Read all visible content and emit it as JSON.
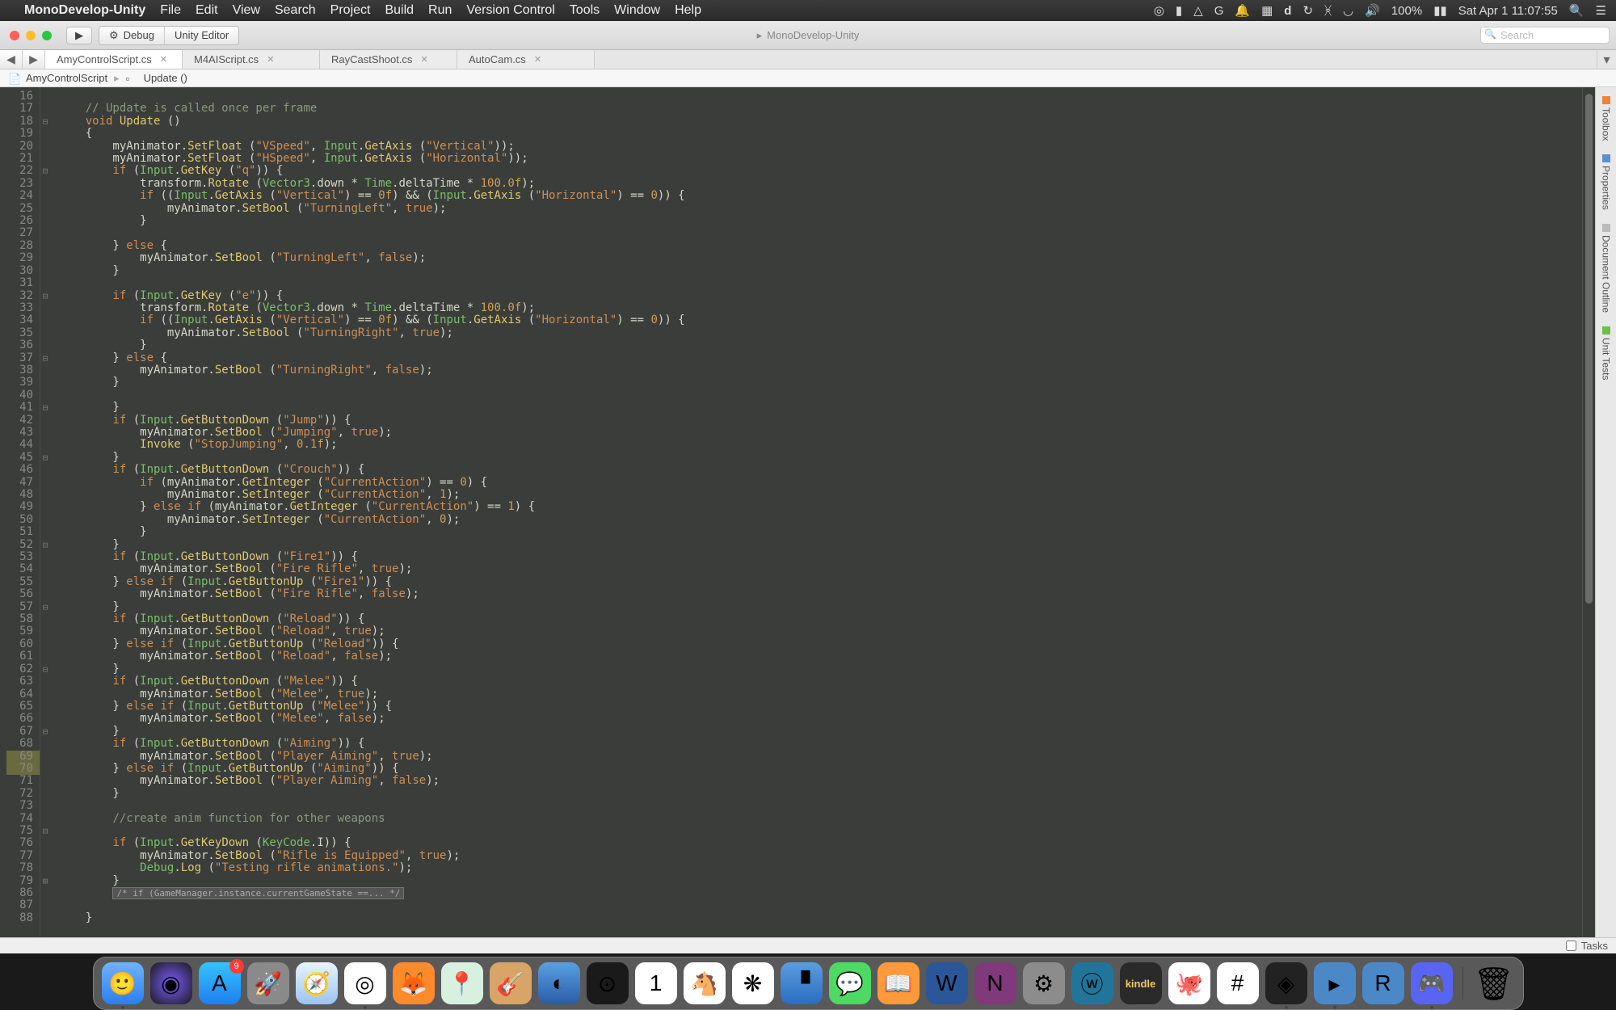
{
  "menubar": {
    "app_name": "MonoDevelop-Unity",
    "items": [
      "File",
      "Edit",
      "View",
      "Search",
      "Project",
      "Build",
      "Run",
      "Version Control",
      "Tools",
      "Window",
      "Help"
    ],
    "status": {
      "battery": "100%",
      "clock": "Sat Apr 1  11:07:55"
    }
  },
  "toolbar": {
    "run_config": "Debug",
    "target": "Unity Editor",
    "app_title": "MonoDevelop-Unity",
    "search_placeholder": "Search"
  },
  "tabs": [
    {
      "label": "AmyControlScript.cs",
      "active": true
    },
    {
      "label": "M4AIScript.cs",
      "active": false
    },
    {
      "label": "RayCastShoot.cs",
      "active": false
    },
    {
      "label": "AutoCam.cs",
      "active": false
    }
  ],
  "breadcrumb": {
    "file": "AmyControlScript",
    "member": "Update ()"
  },
  "side_panels": [
    "Toolbox",
    "Properties",
    "Document Outline",
    "Unit Tests"
  ],
  "tasks_label": "Tasks",
  "editor": {
    "first_line_no": 16,
    "marked_lines": [
      69,
      70
    ],
    "fold_markers": {
      "18": "⊟",
      "22": "⊟",
      "32": "⊟",
      "37": "⊟",
      "41": "⊟",
      "45": "⊟",
      "52": "⊟",
      "57": "⊟",
      "62": "⊟",
      "67": "⊟",
      "75": "⊟",
      "79": "⊞"
    },
    "lines_html": [
      "",
      "    <span class='c-cmt'>// Update is called once per frame</span>",
      "    <span class='c-kw'>void</span> <span class='c-call'>Update</span> ()",
      "    {",
      "        myAnimator.<span class='c-call'>SetFloat</span> (<span class='c-str'>\"VSpeed\"</span>, <span class='c-call2'>Input</span>.<span class='c-call'>GetAxis</span> (<span class='c-str'>\"Vertical\"</span>));",
      "        myAnimator.<span class='c-call'>SetFloat</span> (<span class='c-str'>\"HSpeed\"</span>, <span class='c-call2'>Input</span>.<span class='c-call'>GetAxis</span> (<span class='c-str'>\"Horizontal\"</span>));",
      "        <span class='c-kw'>if</span> (<span class='c-call2'>Input</span>.<span class='c-call'>GetKey</span> (<span class='c-str'>\"q\"</span>)) {",
      "            transform.<span class='c-call'>Rotate</span> (<span class='c-call2'>Vector3</span>.down * <span class='c-call2'>Time</span>.deltaTime * <span class='c-num'>100.0f</span>);",
      "            <span class='c-kw'>if</span> ((<span class='c-call2'>Input</span>.<span class='c-call'>GetAxis</span> (<span class='c-str'>\"Vertical\"</span>) == <span class='c-num'>0f</span>) &amp;&amp; (<span class='c-call2'>Input</span>.<span class='c-call'>GetAxis</span> (<span class='c-str'>\"Horizontal\"</span>) == <span class='c-num'>0</span>)) {",
      "                myAnimator.<span class='c-call'>SetBool</span> (<span class='c-str'>\"TurningLeft\"</span>, <span class='c-kw'>true</span>);",
      "            }",
      "",
      "        } <span class='c-kw'>else</span> {",
      "            myAnimator.<span class='c-call'>SetBool</span> (<span class='c-str'>\"TurningLeft\"</span>, <span class='c-kw'>false</span>);",
      "        }",
      "",
      "        <span class='c-kw'>if</span> (<span class='c-call2'>Input</span>.<span class='c-call'>GetKey</span> (<span class='c-str'>\"e\"</span>)) {",
      "            transform.<span class='c-call'>Rotate</span> (<span class='c-call2'>Vector3</span>.down * <span class='c-call2'>Time</span>.deltaTime * <span class='c-num'>100.0f</span>);",
      "            <span class='c-kw'>if</span> ((<span class='c-call2'>Input</span>.<span class='c-call'>GetAxis</span> (<span class='c-str'>\"Vertical\"</span>) == <span class='c-num'>0f</span>) &amp;&amp; (<span class='c-call2'>Input</span>.<span class='c-call'>GetAxis</span> (<span class='c-str'>\"Horizontal\"</span>) == <span class='c-num'>0</span>)) {",
      "                myAnimator.<span class='c-call'>SetBool</span> (<span class='c-str'>\"TurningRight\"</span>, <span class='c-kw'>true</span>);",
      "            }",
      "        } <span class='c-kw'>else</span> {",
      "            myAnimator.<span class='c-call'>SetBool</span> (<span class='c-str'>\"TurningRight\"</span>, <span class='c-kw'>false</span>);",
      "        }",
      "",
      "        }",
      "        <span class='c-kw'>if</span> (<span class='c-call2'>Input</span>.<span class='c-call'>GetButtonDown</span> (<span class='c-str'>\"Jump\"</span>)) {",
      "            myAnimator.<span class='c-call'>SetBool</span> (<span class='c-str'>\"Jumping\"</span>, <span class='c-kw'>true</span>);",
      "            <span class='c-call'>Invoke</span> (<span class='c-str'>\"StopJumping\"</span>, <span class='c-num'>0.1f</span>);",
      "        }",
      "        <span class='c-kw'>if</span> (<span class='c-call2'>Input</span>.<span class='c-call'>GetButtonDown</span> (<span class='c-str'>\"Crouch\"</span>)) {",
      "            <span class='c-kw'>if</span> (myAnimator.<span class='c-call'>GetInteger</span> (<span class='c-str'>\"CurrentAction\"</span>) == <span class='c-num'>0</span>) {",
      "                myAnimator.<span class='c-call'>SetInteger</span> (<span class='c-str'>\"CurrentAction\"</span>, <span class='c-num'>1</span>);",
      "            } <span class='c-kw'>else if</span> (myAnimator.<span class='c-call'>GetInteger</span> (<span class='c-str'>\"CurrentAction\"</span>) == <span class='c-num'>1</span>) {",
      "                myAnimator.<span class='c-call'>SetInteger</span> (<span class='c-str'>\"CurrentAction\"</span>, <span class='c-num'>0</span>);",
      "            }",
      "        }",
      "        <span class='c-kw'>if</span> (<span class='c-call2'>Input</span>.<span class='c-call'>GetButtonDown</span> (<span class='c-str'>\"Fire1\"</span>)) {",
      "            myAnimator.<span class='c-call'>SetBool</span> (<span class='c-str'>\"Fire Rifle\"</span>, <span class='c-kw'>true</span>);",
      "        } <span class='c-kw'>else if</span> (<span class='c-call2'>Input</span>.<span class='c-call'>GetButtonUp</span> (<span class='c-str'>\"Fire1\"</span>)) {",
      "            myAnimator.<span class='c-call'>SetBool</span> (<span class='c-str'>\"Fire Rifle\"</span>, <span class='c-kw'>false</span>);",
      "        }",
      "        <span class='c-kw'>if</span> (<span class='c-call2'>Input</span>.<span class='c-call'>GetButtonDown</span> (<span class='c-str'>\"Reload\"</span>)) {",
      "            myAnimator.<span class='c-call'>SetBool</span> (<span class='c-str'>\"Reload\"</span>, <span class='c-kw'>true</span>);",
      "        } <span class='c-kw'>else if</span> (<span class='c-call2'>Input</span>.<span class='c-call'>GetButtonUp</span> (<span class='c-str'>\"Reload\"</span>)) {",
      "            myAnimator.<span class='c-call'>SetBool</span> (<span class='c-str'>\"Reload\"</span>, <span class='c-kw'>false</span>);",
      "        }",
      "        <span class='c-kw'>if</span> (<span class='c-call2'>Input</span>.<span class='c-call'>GetButtonDown</span> (<span class='c-str'>\"Melee\"</span>)) {",
      "            myAnimator.<span class='c-call'>SetBool</span> (<span class='c-str'>\"Melee\"</span>, <span class='c-kw'>true</span>);",
      "        } <span class='c-kw'>else if</span> (<span class='c-call2'>Input</span>.<span class='c-call'>GetButtonUp</span> (<span class='c-str'>\"Melee\"</span>)) {",
      "            myAnimator.<span class='c-call'>SetBool</span> (<span class='c-str'>\"Melee\"</span>, <span class='c-kw'>false</span>);",
      "        }",
      "        <span class='c-kw'>if</span> (<span class='c-call2'>Input</span>.<span class='c-call'>GetButtonDown</span> (<span class='c-str'>\"Aiming\"</span>)) {",
      "            myAnimator.<span class='c-call'>SetBool</span> (<span class='c-str'>\"Player Aiming\"</span>, <span class='c-kw'>true</span>);",
      "        } <span class='c-kw'>else if</span> (<span class='c-call2'>Input</span>.<span class='c-call'>GetButtonUp</span> (<span class='c-str'>\"Aiming\"</span>)) {",
      "            myAnimator.<span class='c-call'>SetBool</span> (<span class='c-str'>\"Player Aiming\"</span>, <span class='c-kw'>false</span>);",
      "        }",
      "",
      "        <span class='c-cmt'>//create anim function for other weapons</span>",
      "",
      "        <span class='c-kw'>if</span> (<span class='c-call2'>Input</span>.<span class='c-call'>GetKeyDown</span> (<span class='c-call2'>KeyCode</span>.I)) {",
      "            myAnimator.<span class='c-call'>SetBool</span> (<span class='c-str'>\"Rifle is Equipped\"</span>, <span class='c-kw'>true</span>);",
      "            <span class='c-call2'>Debug</span>.<span class='c-call'>Log</span> (<span class='c-str'>\"Testing rifle animations.\"</span>);",
      "        }",
      "        <span class='c-fold'>/* if (GameManager.instance.currentGameState ==... */</span>",
      "",
      "    }",
      ""
    ],
    "line_number_sequence": [
      16,
      17,
      18,
      19,
      20,
      21,
      22,
      23,
      24,
      25,
      26,
      27,
      28,
      29,
      30,
      31,
      32,
      33,
      34,
      35,
      36,
      37,
      38,
      39,
      40,
      41,
      42,
      43,
      44,
      45,
      46,
      47,
      48,
      49,
      50,
      51,
      52,
      53,
      54,
      55,
      56,
      57,
      58,
      59,
      60,
      61,
      62,
      63,
      64,
      65,
      66,
      67,
      68,
      69,
      70,
      71,
      72,
      73,
      74,
      75,
      76,
      77,
      78,
      79,
      86,
      87,
      88
    ]
  },
  "dock": {
    "apps": [
      {
        "name": "finder-icon",
        "glyph": "🙂",
        "cls": "bg-finder",
        "running": true
      },
      {
        "name": "siri-icon",
        "glyph": "◉",
        "cls": "bg-siri"
      },
      {
        "name": "appstore-icon",
        "glyph": "A",
        "cls": "bg-appstore",
        "badge": "9"
      },
      {
        "name": "launchpad-icon",
        "glyph": "🚀",
        "cls": "bg-launch"
      },
      {
        "name": "safari-icon",
        "glyph": "🧭",
        "cls": "bg-safari"
      },
      {
        "name": "chrome-icon",
        "glyph": "◎",
        "cls": "bg-chrome",
        "running": true
      },
      {
        "name": "firefox-icon",
        "glyph": "🦊",
        "cls": "bg-ff"
      },
      {
        "name": "maps-icon",
        "glyph": "📍",
        "cls": "bg-maps"
      },
      {
        "name": "garageband-icon",
        "glyph": "🎸",
        "cls": "bg-gb"
      },
      {
        "name": "app-icon",
        "glyph": "◐",
        "cls": "bg-loop"
      },
      {
        "name": "steam-icon",
        "glyph": "⊙",
        "cls": "bg-steam"
      },
      {
        "name": "calendar-icon",
        "glyph": "1",
        "cls": "bg-cal"
      },
      {
        "name": "app2-icon",
        "glyph": "🐴",
        "cls": "bg-pony"
      },
      {
        "name": "photos-icon",
        "glyph": "❋",
        "cls": "bg-photos"
      },
      {
        "name": "keynote-icon",
        "glyph": "▝",
        "cls": "bg-keynote"
      },
      {
        "name": "messages-icon",
        "glyph": "💬",
        "cls": "bg-msg"
      },
      {
        "name": "ibooks-icon",
        "glyph": "📖",
        "cls": "bg-ibooks"
      },
      {
        "name": "word-icon",
        "glyph": "W",
        "cls": "bg-word"
      },
      {
        "name": "onenote-icon",
        "glyph": "N",
        "cls": "bg-onenote"
      },
      {
        "name": "settings-icon",
        "glyph": "⚙",
        "cls": "bg-sys"
      },
      {
        "name": "wordpress-icon",
        "glyph": "ⓦ",
        "cls": "bg-wp"
      },
      {
        "name": "kindle-icon",
        "glyph": "kindle",
        "cls": "bg-kindle"
      },
      {
        "name": "github-icon",
        "glyph": "🐙",
        "cls": "bg-gh"
      },
      {
        "name": "slack-icon",
        "glyph": "#",
        "cls": "bg-slack"
      },
      {
        "name": "unity-icon",
        "glyph": "◈",
        "cls": "bg-unity",
        "running": true
      },
      {
        "name": "monodevelop-icon",
        "glyph": "▸",
        "cls": "bg-mono",
        "running": true
      },
      {
        "name": "app3-icon",
        "glyph": "R",
        "cls": "bg-r"
      },
      {
        "name": "discord-icon",
        "glyph": "🎮",
        "cls": "bg-disc",
        "running": true
      }
    ],
    "trash_glyph": "🗑"
  }
}
